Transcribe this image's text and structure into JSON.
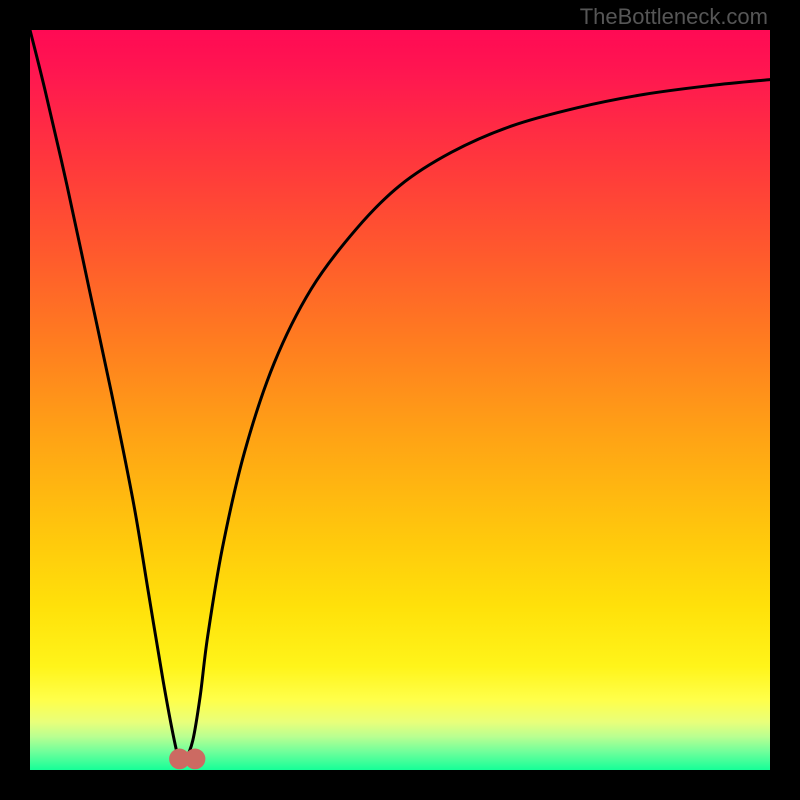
{
  "watermark": "TheBottleneck.com",
  "colors": {
    "frame": "#000000",
    "gradient_stops": [
      {
        "offset": 0.0,
        "color": "#ff0a54"
      },
      {
        "offset": 0.06,
        "color": "#ff1750"
      },
      {
        "offset": 0.18,
        "color": "#ff383c"
      },
      {
        "offset": 0.3,
        "color": "#ff592d"
      },
      {
        "offset": 0.42,
        "color": "#ff7c20"
      },
      {
        "offset": 0.55,
        "color": "#ffa315"
      },
      {
        "offset": 0.67,
        "color": "#ffc40d"
      },
      {
        "offset": 0.78,
        "color": "#ffe10a"
      },
      {
        "offset": 0.86,
        "color": "#fff41a"
      },
      {
        "offset": 0.905,
        "color": "#ffff4a"
      },
      {
        "offset": 0.935,
        "color": "#e9ff7a"
      },
      {
        "offset": 0.955,
        "color": "#b9ff91"
      },
      {
        "offset": 0.975,
        "color": "#71ff9b"
      },
      {
        "offset": 1.0,
        "color": "#16ff98"
      }
    ],
    "curve": "#000000",
    "marker": "#cc6a62"
  },
  "chart_data": {
    "type": "line",
    "title": "",
    "xlabel": "",
    "ylabel": "",
    "xlim": [
      0,
      100
    ],
    "ylim": [
      0,
      100
    ],
    "series": [
      {
        "name": "bottleneck-curve",
        "x": [
          0,
          2,
          5,
          8,
          11,
          14,
          16,
          18,
          19.5,
          20.2,
          21,
          22,
          23,
          24,
          26,
          29,
          33,
          38,
          44,
          50,
          57,
          65,
          74,
          83,
          92,
          100
        ],
        "y": [
          100,
          92,
          79,
          65,
          51,
          36,
          24,
          12,
          4,
          1.5,
          1.5,
          4,
          10,
          18,
          30,
          43,
          55,
          65,
          73,
          79,
          83.5,
          87,
          89.5,
          91.3,
          92.5,
          93.3
        ]
      }
    ],
    "markers": [
      {
        "x": 20.2,
        "y": 1.5,
        "r": 1.4
      },
      {
        "x": 22.3,
        "y": 1.5,
        "r": 1.4
      }
    ],
    "marker_connector": {
      "from": [
        20.2,
        1.5
      ],
      "to": [
        22.3,
        1.5
      ]
    }
  }
}
